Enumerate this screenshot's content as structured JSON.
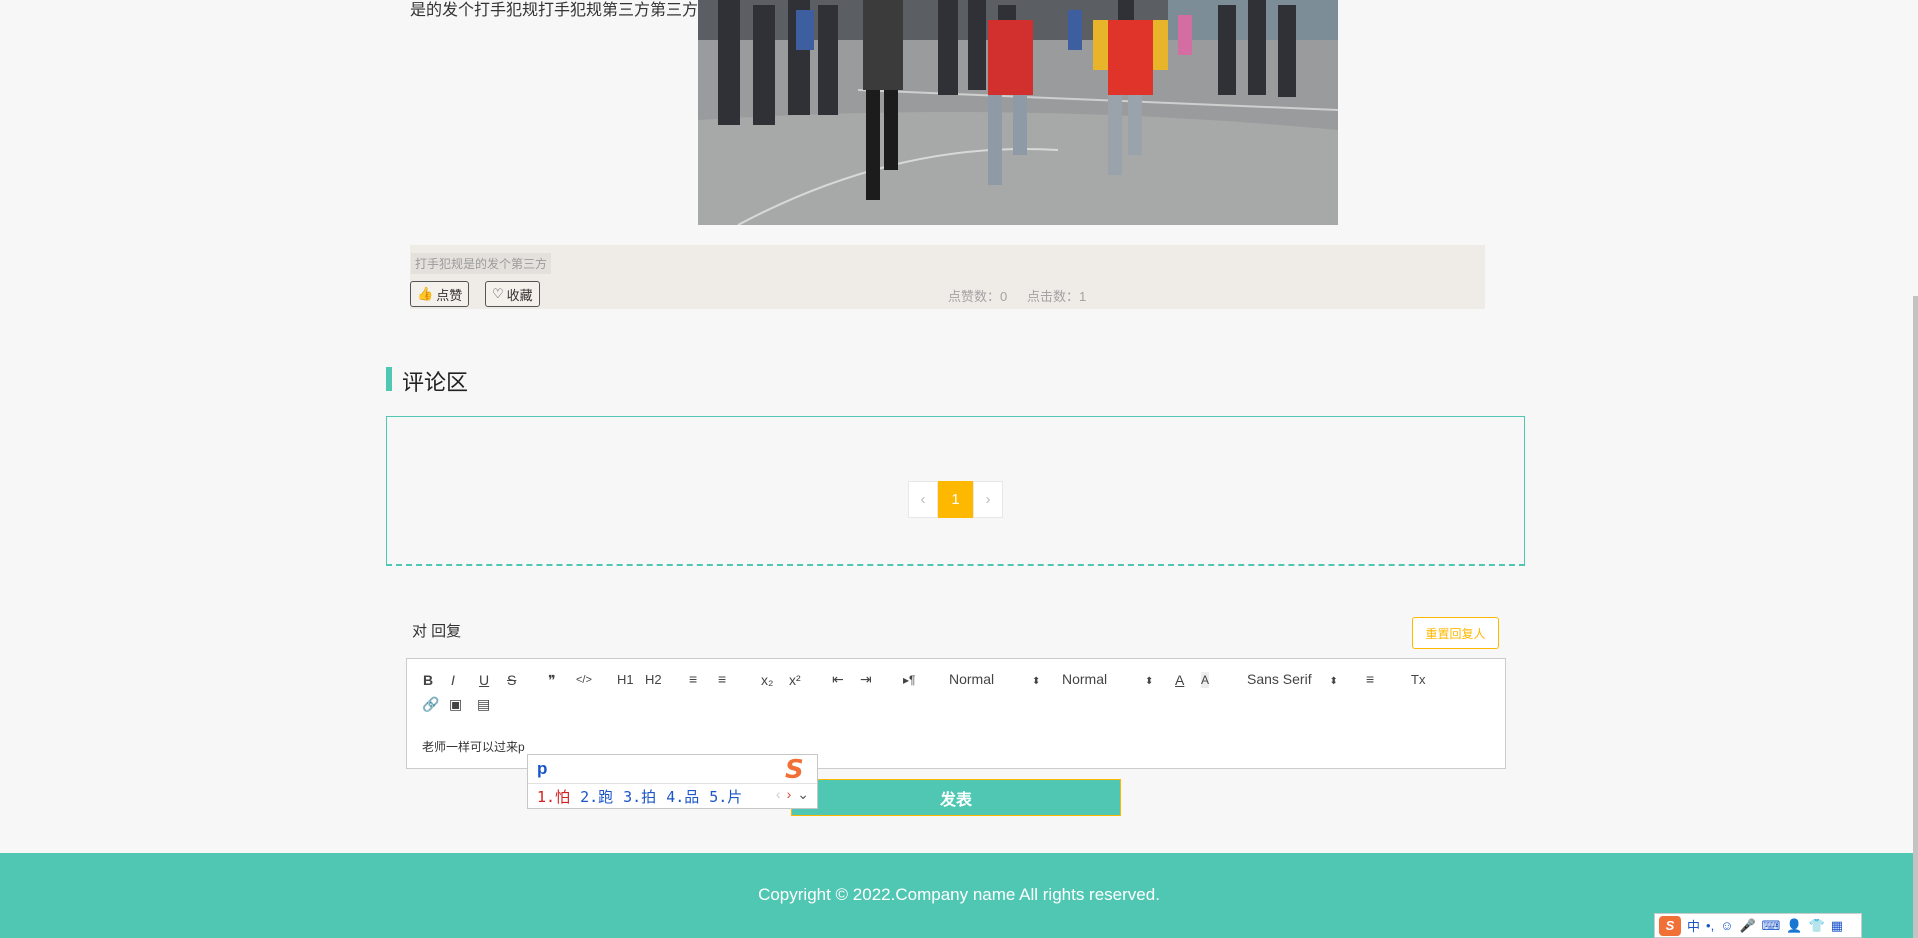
{
  "article": {
    "text": "是的发个打手犯规打手犯规第三方第三方",
    "description": "打手犯规是的发个第三方",
    "like_label": "点赞",
    "favorite_label": "收藏",
    "like_count_label": "点赞数：0",
    "click_count_label": "点击数：1"
  },
  "comments": {
    "title": "评论区",
    "pagination": {
      "prev": "‹",
      "current": "1",
      "next": "›"
    }
  },
  "reply": {
    "label": "对 回复",
    "reset_label": "重置回复人",
    "toolbar": {
      "bold": "B",
      "italic": "I",
      "underline": "U",
      "strike": "S",
      "quote": "❞",
      "code": "</>",
      "h1": "H1",
      "h2": "H2",
      "ordered_list": "≡",
      "bullet_list": "≡",
      "subscript": "x₂",
      "superscript": "x²",
      "outdent": "⇤",
      "indent": "⇥",
      "direction": "▸¶",
      "size_select": "Normal",
      "header_select": "Normal",
      "font_select": "Sans Serif",
      "color": "A",
      "background": "A",
      "align": "≡",
      "clean": "Tx"
    },
    "editor_text": "老师一样可以过来p",
    "submit_label": "发表"
  },
  "ime": {
    "input": "p",
    "candidates": [
      "1.怕",
      "2.跑",
      "3.拍",
      "4.品",
      "5.片"
    ],
    "logo": "S",
    "tray": {
      "logo": "S",
      "mode": "中"
    }
  },
  "footer": {
    "copyright": "Copyright © 2022.Company name All rights reserved."
  },
  "colors": {
    "accent": "#4fc7b3",
    "warning": "#ffb800",
    "ime_red": "#d4211d",
    "ime_blue": "#1b55c9"
  }
}
